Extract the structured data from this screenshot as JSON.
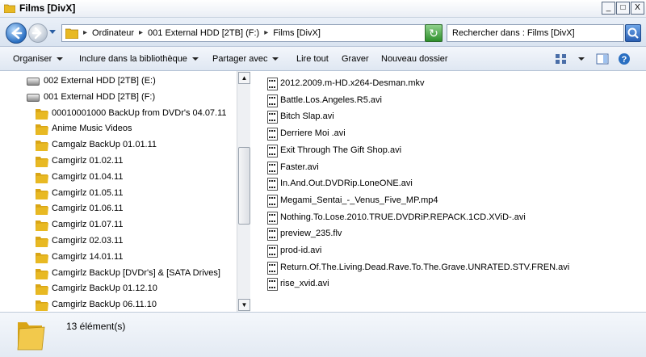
{
  "window": {
    "title": "Films [DivX]",
    "buttons": {
      "minimize": "_",
      "maximize": "□",
      "close": "X"
    }
  },
  "address": {
    "crumbs": [
      "Ordinateur",
      "001 External HDD [2TB] (F:)",
      "Films [DivX]"
    ],
    "separator": "▸",
    "search_placeholder": "Rechercher dans : Films [DivX]",
    "refresh_symbol": "↻"
  },
  "toolbar": {
    "organize": "Organiser",
    "include": "Inclure dans la bibliothèque",
    "share": "Partager avec",
    "play": "Lire tout",
    "burn": "Graver",
    "new_folder": "Nouveau dossier"
  },
  "nav": {
    "drives": [
      {
        "label": "002 External HDD [2TB] (E:)"
      },
      {
        "label": "001 External HDD [2TB] (F:)"
      }
    ],
    "folders": [
      "00010001000 BackUp from DVDr's 04.07.11",
      "Anime Music Videos",
      "Camgalz BackUp 01.01.11",
      "Camgirlz 01.02.11",
      "Camgirlz 01.04.11",
      "Camgirlz 01.05.11",
      "Camgirlz 01.06.11",
      "Camgirlz 01.07.11",
      "Camgirlz 02.03.11",
      "Camgirlz 14.01.11",
      "Camgirlz BackUp [DVDr's] & [SATA Drives]",
      "Camgirlz BackUp 01.12.10",
      "Camgirlz BackUp 06.11.10"
    ],
    "scroll_up": "▲",
    "scroll_down": "▼"
  },
  "files": [
    "2012.2009.m-HD.x264-Desman.mkv",
    "Battle.Los.Angeles.R5.avi",
    "Bitch Slap.avi",
    "Derriere Moi .avi",
    "Exit Through The Gift Shop.avi",
    "Faster.avi",
    "In.And.Out.DVDRip.LoneONE.avi",
    "Megami_Sentai_-_Venus_Five_MP.mp4",
    "Nothing.To.Lose.2010.TRUE.DVDRiP.REPACK.1CD.XViD-.avi",
    "preview_235.flv",
    "prod-id.avi",
    "Return.Of.The.Living.Dead.Rave.To.The.Grave.UNRATED.STV.FREN.avi",
    "rise_xvid.avi"
  ],
  "details": {
    "count": "13 élément(s)"
  },
  "colors": {
    "folder": "#e8b923",
    "accent": "#2a6fc2",
    "refresh": "#2e8f2b"
  }
}
